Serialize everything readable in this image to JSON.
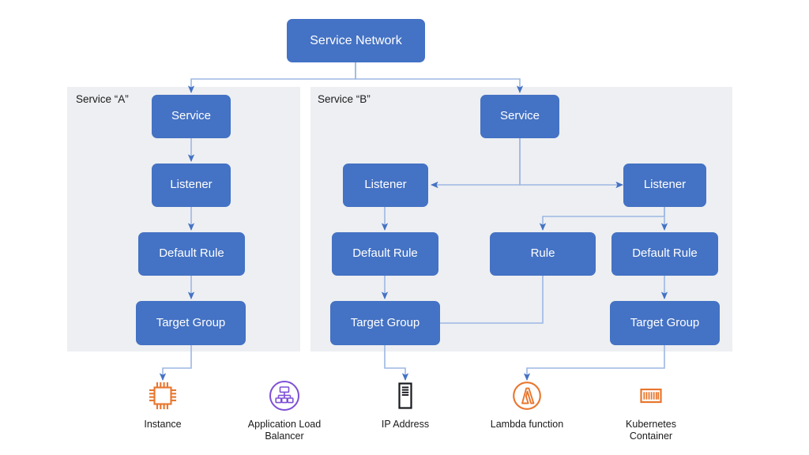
{
  "diagram": {
    "title": "Service Network",
    "colors": {
      "node_fill": "#4472C4",
      "panel_bg": "#EDEFF2",
      "connector": "#9DB7E3",
      "arrow": "#4472C4",
      "orange": "#E8762D",
      "purple": "#7D4FD6",
      "black": "#16191F"
    },
    "root": {
      "label": "Service Network"
    },
    "groups": [
      {
        "id": "service-a",
        "label": "Service “A”",
        "nodes": [
          {
            "id": "a-service",
            "label": "Service"
          },
          {
            "id": "a-listener",
            "label": "Listener"
          },
          {
            "id": "a-default-rule",
            "label": "Default Rule"
          },
          {
            "id": "a-target-group",
            "label": "Target Group"
          }
        ]
      },
      {
        "id": "service-b",
        "label": "Service “B”",
        "nodes": [
          {
            "id": "b-service",
            "label": "Service"
          },
          {
            "id": "b-listener-left",
            "label": "Listener"
          },
          {
            "id": "b-listener-right",
            "label": "Listener"
          },
          {
            "id": "b-default-rule-left",
            "label": "Default Rule"
          },
          {
            "id": "b-rule",
            "label": "Rule"
          },
          {
            "id": "b-default-rule-right",
            "label": "Default Rule"
          },
          {
            "id": "b-target-group-left",
            "label": "Target Group"
          },
          {
            "id": "b-target-group-right",
            "label": "Target Group"
          }
        ]
      }
    ],
    "legend": [
      {
        "id": "instance",
        "label": "Instance",
        "icon": "instance-chip-icon"
      },
      {
        "id": "alb",
        "label": "Application Load\nBalancer",
        "icon": "application-load-balancer-icon"
      },
      {
        "id": "ip-address",
        "label": "IP Address",
        "icon": "ip-address-server-icon"
      },
      {
        "id": "lambda",
        "label": "Lambda function",
        "icon": "lambda-function-icon"
      },
      {
        "id": "kubernetes",
        "label": "Kubernetes\nContainer",
        "icon": "kubernetes-container-icon"
      }
    ]
  }
}
